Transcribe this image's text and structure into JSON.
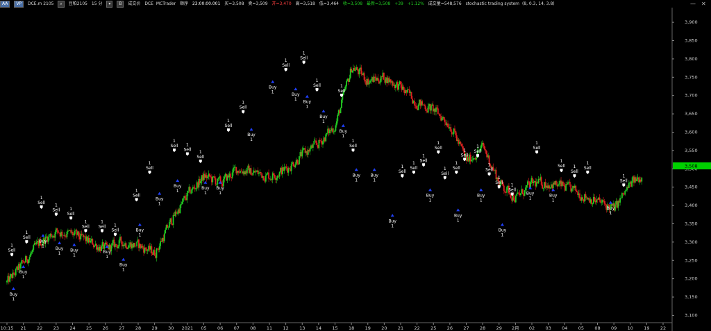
{
  "toolbar": {
    "btn_aa": "AA",
    "btn_vp": "VP",
    "symbol_code": "DCE.m 2105",
    "symbol_name": "豆粕2105",
    "interval": "15 分",
    "btn_dropdown": "▾",
    "btn_b": "B",
    "label_volume_type": "成交价",
    "exchange": "DCE",
    "software": "MCTrader",
    "label_seq": "顺序",
    "time": "23:00:00.001",
    "buy": "买=3,508",
    "sell": "卖=3,509",
    "open": "开=3,470",
    "high": "高=3,518",
    "low": "低=3,464",
    "close": "收=3,508",
    "last": "最新=3,508",
    "change": "+39",
    "change_pct": "+1.12%",
    "volume": "成交量=548,576",
    "strategy": "stochastic trading system",
    "strategy_params": "(8,  0.3,  14,  3.8)"
  },
  "window_controls": {
    "minimize": "—",
    "close": "✕"
  },
  "colors": {
    "bull": "#22cc22",
    "bear": "#e02020",
    "buy_marker": "#2040ff",
    "sell_marker": "#ffffff",
    "price_tag_bg": "#00d000",
    "axis_text": "#cccccc"
  },
  "chart_data": {
    "type": "candlestick",
    "title": "",
    "price_tag": "3,508",
    "y_ticks": [
      "3,900",
      "3,850",
      "3,800",
      "3,750",
      "3,700",
      "3,650",
      "3,600",
      "3,550",
      "3,500",
      "3,450",
      "3,400",
      "3,350",
      "3,300",
      "3,250",
      "3,200",
      "3,150",
      "3,100"
    ],
    "ylim": [
      3080,
      3940
    ],
    "x_labels": [
      "10:15",
      "21",
      "22",
      "23",
      "24",
      "25",
      "26",
      "27",
      "28",
      "29",
      "30",
      "2021",
      "05",
      "06",
      "07",
      "08",
      "11",
      "12",
      "13",
      "14",
      "15",
      "18",
      "19",
      "20",
      "21",
      "22",
      "25",
      "26",
      "27",
      "28",
      "29",
      "2月",
      "02",
      "03",
      "04",
      "05",
      "08",
      "09",
      "10",
      "19",
      "22"
    ],
    "close_series": {
      "x": [
        0,
        2,
        3,
        4,
        5,
        6,
        7,
        8,
        9,
        10,
        11,
        12,
        13,
        14,
        15,
        16,
        17,
        18,
        19,
        20,
        21,
        22,
        23,
        24,
        25,
        26,
        27,
        28,
        29,
        30,
        31,
        32,
        33,
        34,
        35,
        36,
        37,
        38,
        39,
        40
      ],
      "close": [
        3190,
        3300,
        3330,
        3320,
        3300,
        3280,
        3300,
        3290,
        3270,
        3360,
        3430,
        3480,
        3460,
        3500,
        3490,
        3480,
        3500,
        3540,
        3570,
        3620,
        3780,
        3740,
        3750,
        3720,
        3680,
        3660,
        3620,
        3520,
        3560,
        3460,
        3420,
        3460,
        3460,
        3450,
        3430,
        3410,
        3390,
        3460,
        3490,
        3480,
        3470
      ]
    },
    "signals": [
      {
        "type": "sell",
        "x": 0.3,
        "price": 3255,
        "label1": "1",
        "label2": "Sell"
      },
      {
        "type": "buy",
        "x": 1.0,
        "price": 3235,
        "label1": "Buy",
        "label2": "1"
      },
      {
        "type": "buy",
        "x": 0.4,
        "price": 3175,
        "label1": "Buy",
        "label2": "1"
      },
      {
        "type": "sell",
        "x": 1.2,
        "price": 3290,
        "label1": "1",
        "label2": "Sell"
      },
      {
        "type": "sell",
        "x": 2.1,
        "price": 3385,
        "label1": "1",
        "label2": "Sell"
      },
      {
        "type": "buy",
        "x": 2.2,
        "price": 3320,
        "label1": "Buy",
        "label2": "1"
      },
      {
        "type": "sell",
        "x": 3.0,
        "price": 3365,
        "label1": "1",
        "label2": "Sell"
      },
      {
        "type": "buy",
        "x": 3.2,
        "price": 3300,
        "label1": "Buy",
        "label2": "1"
      },
      {
        "type": "sell",
        "x": 3.9,
        "price": 3355,
        "label1": "1",
        "label2": "Sell"
      },
      {
        "type": "buy",
        "x": 4.1,
        "price": 3295,
        "label1": "Buy",
        "label2": "1"
      },
      {
        "type": "sell",
        "x": 4.8,
        "price": 3320,
        "label1": "1",
        "label2": "Sell"
      },
      {
        "type": "sell",
        "x": 5.8,
        "price": 3320,
        "label1": "1",
        "label2": "Sell"
      },
      {
        "type": "buy",
        "x": 6.1,
        "price": 3290,
        "label1": "Buy",
        "label2": "1"
      },
      {
        "type": "sell",
        "x": 6.6,
        "price": 3310,
        "label1": "1",
        "label2": "Sell"
      },
      {
        "type": "buy",
        "x": 7.1,
        "price": 3255,
        "label1": "Buy",
        "label2": "1"
      },
      {
        "type": "sell",
        "x": 7.9,
        "price": 3405,
        "label1": "1",
        "label2": "Sell"
      },
      {
        "type": "buy",
        "x": 8.1,
        "price": 3350,
        "label1": "Buy",
        "label2": "1"
      },
      {
        "type": "sell",
        "x": 8.7,
        "price": 3480,
        "label1": "1",
        "label2": "Sell"
      },
      {
        "type": "buy",
        "x": 9.3,
        "price": 3435,
        "label1": "Buy",
        "label2": "1"
      },
      {
        "type": "sell",
        "x": 10.2,
        "price": 3540,
        "label1": "1",
        "label2": "Sell"
      },
      {
        "type": "buy",
        "x": 10.4,
        "price": 3470,
        "label1": "Buy",
        "label2": "1"
      },
      {
        "type": "sell",
        "x": 11.0,
        "price": 3530,
        "label1": "1",
        "label2": "Sell"
      },
      {
        "type": "sell",
        "x": 11.8,
        "price": 3510,
        "label1": "1",
        "label2": "Sell"
      },
      {
        "type": "buy",
        "x": 12.1,
        "price": 3465,
        "label1": "Buy",
        "label2": "1"
      },
      {
        "type": "buy",
        "x": 13.0,
        "price": 3465,
        "label1": "Buy",
        "label2": "1"
      },
      {
        "type": "sell",
        "x": 13.5,
        "price": 3595,
        "label1": "1",
        "label2": "Sell"
      },
      {
        "type": "sell",
        "x": 14.4,
        "price": 3645,
        "label1": "1",
        "label2": "Sell"
      },
      {
        "type": "buy",
        "x": 14.9,
        "price": 3610,
        "label1": "Buy",
        "label2": "1"
      },
      {
        "type": "buy",
        "x": 16.2,
        "price": 3740,
        "label1": "Buy",
        "label2": "1"
      },
      {
        "type": "sell",
        "x": 17.0,
        "price": 3760,
        "label1": "1",
        "label2": "Sell"
      },
      {
        "type": "buy",
        "x": 17.6,
        "price": 3720,
        "label1": "Buy",
        "label2": "1"
      },
      {
        "type": "sell",
        "x": 18.1,
        "price": 3780,
        "label1": "1",
        "label2": "Sell"
      },
      {
        "type": "buy",
        "x": 18.3,
        "price": 3700,
        "label1": "Buy",
        "label2": "1"
      },
      {
        "type": "sell",
        "x": 18.9,
        "price": 3705,
        "label1": "1",
        "label2": "Sell"
      },
      {
        "type": "buy",
        "x": 19.3,
        "price": 3660,
        "label1": "Buy",
        "label2": "1"
      },
      {
        "type": "sell",
        "x": 20.4,
        "price": 3690,
        "label1": "1",
        "label2": "Sell"
      },
      {
        "type": "buy",
        "x": 20.5,
        "price": 3620,
        "label1": "Buy",
        "label2": "1"
      },
      {
        "type": "sell",
        "x": 21.1,
        "price": 3540,
        "label1": "1",
        "label2": "Sell"
      },
      {
        "type": "buy",
        "x": 21.3,
        "price": 3500,
        "label1": "Buy",
        "label2": "1"
      },
      {
        "type": "buy",
        "x": 22.4,
        "price": 3500,
        "label1": "Buy",
        "label2": "1"
      },
      {
        "type": "buy",
        "x": 23.5,
        "price": 3375,
        "label1": "Buy",
        "label2": "1"
      },
      {
        "type": "sell",
        "x": 24.1,
        "price": 3470,
        "label1": "1",
        "label2": "Sell"
      },
      {
        "type": "sell",
        "x": 24.8,
        "price": 3480,
        "label1": "1",
        "label2": "Sell"
      },
      {
        "type": "sell",
        "x": 25.4,
        "price": 3500,
        "label1": "1",
        "label2": "Sell"
      },
      {
        "type": "buy",
        "x": 25.8,
        "price": 3445,
        "label1": "Buy",
        "label2": "1"
      },
      {
        "type": "sell",
        "x": 26.3,
        "price": 3535,
        "label1": "1",
        "label2": "Sell"
      },
      {
        "type": "sell",
        "x": 26.7,
        "price": 3465,
        "label1": "1",
        "label2": "Sell"
      },
      {
        "type": "sell",
        "x": 27.4,
        "price": 3480,
        "label1": "1",
        "label2": "Sell"
      },
      {
        "type": "buy",
        "x": 27.5,
        "price": 3390,
        "label1": "Buy",
        "label2": "1"
      },
      {
        "type": "sell",
        "x": 27.9,
        "price": 3515,
        "label1": "1",
        "label2": "Sell"
      },
      {
        "type": "sell",
        "x": 28.7,
        "price": 3525,
        "label1": "1",
        "label2": "Sell"
      },
      {
        "type": "buy",
        "x": 28.9,
        "price": 3445,
        "label1": "Buy",
        "label2": "1"
      },
      {
        "type": "sell",
        "x": 29.4,
        "price": 3475,
        "label1": "1",
        "label2": "Sell"
      },
      {
        "type": "sell",
        "x": 30.0,
        "price": 3440,
        "label1": "1",
        "label2": "Sell"
      },
      {
        "type": "buy",
        "x": 30.2,
        "price": 3350,
        "label1": "Buy",
        "label2": "1"
      },
      {
        "type": "sell",
        "x": 30.8,
        "price": 3420,
        "label1": "1",
        "label2": "Sell"
      },
      {
        "type": "buy",
        "x": 31.9,
        "price": 3450,
        "label1": "Buy",
        "label2": "1"
      },
      {
        "type": "sell",
        "x": 32.3,
        "price": 3535,
        "label1": "1",
        "label2": "Sell"
      },
      {
        "type": "buy",
        "x": 33.3,
        "price": 3445,
        "label1": "Buy",
        "label2": "1"
      },
      {
        "type": "sell",
        "x": 33.8,
        "price": 3485,
        "label1": "1",
        "label2": "Sell"
      },
      {
        "type": "sell",
        "x": 34.6,
        "price": 3470,
        "label1": "1",
        "label2": "Sell"
      },
      {
        "type": "sell",
        "x": 35.4,
        "price": 3480,
        "label1": "1",
        "label2": "Sell"
      },
      {
        "type": "buy",
        "x": 36.8,
        "price": 3410,
        "label1": "Buy",
        "label2": "1"
      },
      {
        "type": "sell",
        "x": 37.6,
        "price": 3445,
        "label1": "1",
        "label2": "Sell"
      }
    ]
  }
}
